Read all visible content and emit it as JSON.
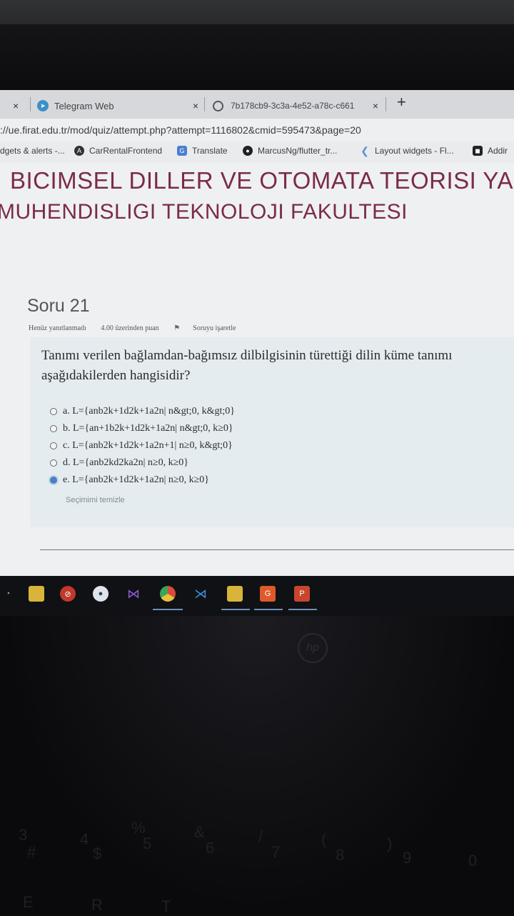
{
  "browser": {
    "tabs": [
      {
        "label": "",
        "favicon": "generic"
      },
      {
        "label": "Telegram Web",
        "favicon": "telegram-icon"
      },
      {
        "label": "7b178cb9-3c3a-4e52-a78c-c661",
        "favicon": "globe-icon"
      }
    ],
    "close_glyph": "×",
    "new_tab_glyph": "+",
    "address": "://ue.firat.edu.tr/mod/quiz/attempt.php?attempt=1116802&cmid=595473&page=20",
    "bookmarks": [
      {
        "label": "dgets & alerts -...",
        "icon": "generic"
      },
      {
        "label": "CarRentalFrontend",
        "icon": "angular-icon"
      },
      {
        "label": "Translate",
        "icon": "translate-icon"
      },
      {
        "label": "MarcusNg/flutter_tr...",
        "icon": "github-icon"
      },
      {
        "label": "Layout widgets - Fl...",
        "icon": "flutter-icon"
      },
      {
        "label": "Addir",
        "icon": "bookmark-icon"
      }
    ]
  },
  "course": {
    "line1": "BICIMSEL DILLER VE OTOMATA TEORISI YAZ",
    "line2": "MUHENDISLIGI TEKNOLOJI FAKULTESI"
  },
  "question": {
    "title": "Soru 21",
    "status": "Henüz yanıtlanmadı",
    "points": "4.00 üzerinden puan",
    "flag_label": "Soruyu işaretle",
    "text": "Tanımı verilen bağlamdan-bağımsız dilbilgisinin türettiği dilin küme tanımı aşağıdakilerden hangisidir?",
    "options": [
      {
        "label": "a. L={anb2k+1d2k+1a2n| n&gt;0, k&gt;0}",
        "selected": false
      },
      {
        "label": "b. L={an+1b2k+1d2k+1a2n| n&gt;0, k≥0}",
        "selected": false
      },
      {
        "label": "c. L={anb2k+1d2k+1a2n+1| n≥0, k&gt;0}",
        "selected": false
      },
      {
        "label": "d. L={anb2kd2ka2n| n≥0, k≥0}",
        "selected": false
      },
      {
        "label": "e. L={anb2k+1d2k+1a2n| n≥0, k≥0}",
        "selected": true
      }
    ],
    "clear_label": "Seçimimi temizle"
  },
  "taskbar": {
    "apps": [
      "chat-icon",
      "sticky-notes-icon",
      "opera-icon",
      "app-icon",
      "visual-studio-icon",
      "chrome-icon",
      "vscode-icon",
      "file-explorer-icon",
      "app2-icon",
      "powerpoint-icon"
    ]
  },
  "keyboard": {
    "brand_mark": "hp",
    "keys": [
      "3",
      "#",
      "4",
      "$",
      "%",
      "5",
      "&",
      "6",
      "/",
      "7",
      "(",
      "8",
      ")",
      "9",
      "0",
      "E",
      "R",
      "T"
    ]
  },
  "colors": {
    "course_title": "#7b2a4a",
    "selected_radio": "#4a7fc0",
    "question_bg": "#e4ecef"
  }
}
